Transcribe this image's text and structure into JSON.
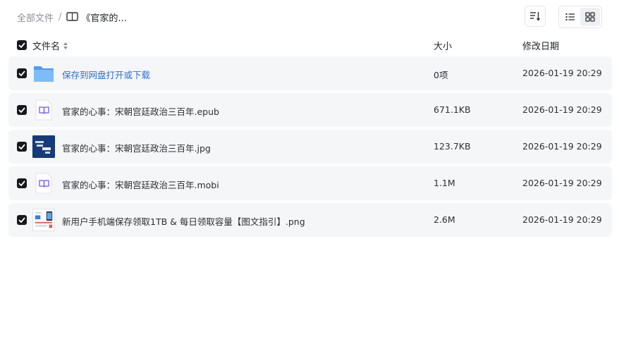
{
  "breadcrumb": {
    "root": "全部文件",
    "separator": "/",
    "current": "《官家的..."
  },
  "table": {
    "headers": {
      "name": "文件名",
      "size": "大小",
      "modified": "修改日期"
    },
    "rows": [
      {
        "name": "保存到网盘打开或下载",
        "size": "0项",
        "modified": "2026-01-19 20:29",
        "icon": "folder-icon",
        "link": true
      },
      {
        "name": "官家的心事：宋朝宫廷政治三百年.epub",
        "size": "671.1KB",
        "modified": "2026-01-19 20:29",
        "icon": "ebook-icon"
      },
      {
        "name": "官家的心事：宋朝宫廷政治三百年.jpg",
        "size": "123.7KB",
        "modified": "2026-01-19 20:29",
        "icon": "image-thumbnail"
      },
      {
        "name": "官家的心事：宋朝宫廷政治三百年.mobi",
        "size": "1.1M",
        "modified": "2026-01-19 20:29",
        "icon": "ebook-icon"
      },
      {
        "name": "新用户手机端保存领取1TB & 每日领取容量【图文指引】.png",
        "size": "2.6M",
        "modified": "2026-01-19 20:29",
        "icon": "image-thumbnail"
      }
    ]
  },
  "colors": {
    "link": "#2a6fdb",
    "row_bg": "#f5f6f7",
    "checkbox": "#16181d",
    "folder": "#5aa7f0",
    "ebook": "#8a6cf0"
  }
}
